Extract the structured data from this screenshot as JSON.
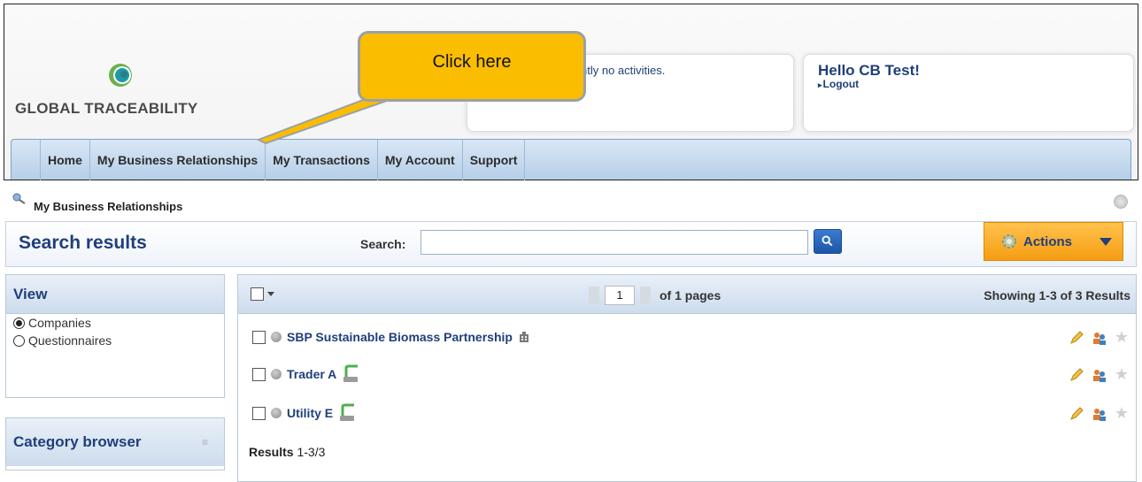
{
  "brand": {
    "name": "GLOBAL TRACEABILITY"
  },
  "activities": {
    "text": "ntly no activities."
  },
  "user": {
    "greeting": "Hello CB Test!",
    "logout": "Logout"
  },
  "callout": {
    "text": "Click here"
  },
  "nav": {
    "items": [
      {
        "label": "Home"
      },
      {
        "label": "My Business Relationships"
      },
      {
        "label": "My Transactions"
      },
      {
        "label": "My Account"
      },
      {
        "label": "Support"
      }
    ]
  },
  "breadcrumb": "My Business Relationships",
  "search": {
    "title": "Search results",
    "label": "Search:",
    "value": "",
    "placeholder": ""
  },
  "actions": {
    "label": "Actions"
  },
  "view": {
    "title": "View",
    "options": [
      {
        "label": "Companies",
        "selected": true
      },
      {
        "label": "Questionnaires",
        "selected": false
      }
    ]
  },
  "category": {
    "title": "Category browser"
  },
  "pager": {
    "page": "1",
    "of_text": "of 1 pages",
    "showing": "Showing 1-3 of 3 Results"
  },
  "results": {
    "rows": [
      {
        "name": "SBP Sustainable Biomass Partnership",
        "icon": "building-icon"
      },
      {
        "name": "Trader A",
        "icon": "trader-icon"
      },
      {
        "name": "Utility E",
        "icon": "trader-icon"
      }
    ],
    "footer_label": "Results",
    "footer_range": "1-3/3"
  },
  "colors": {
    "accent": "#1f3f7a",
    "callout": "#fbbd00",
    "actions": "#f59d12",
    "nav": "#c8dbef"
  }
}
